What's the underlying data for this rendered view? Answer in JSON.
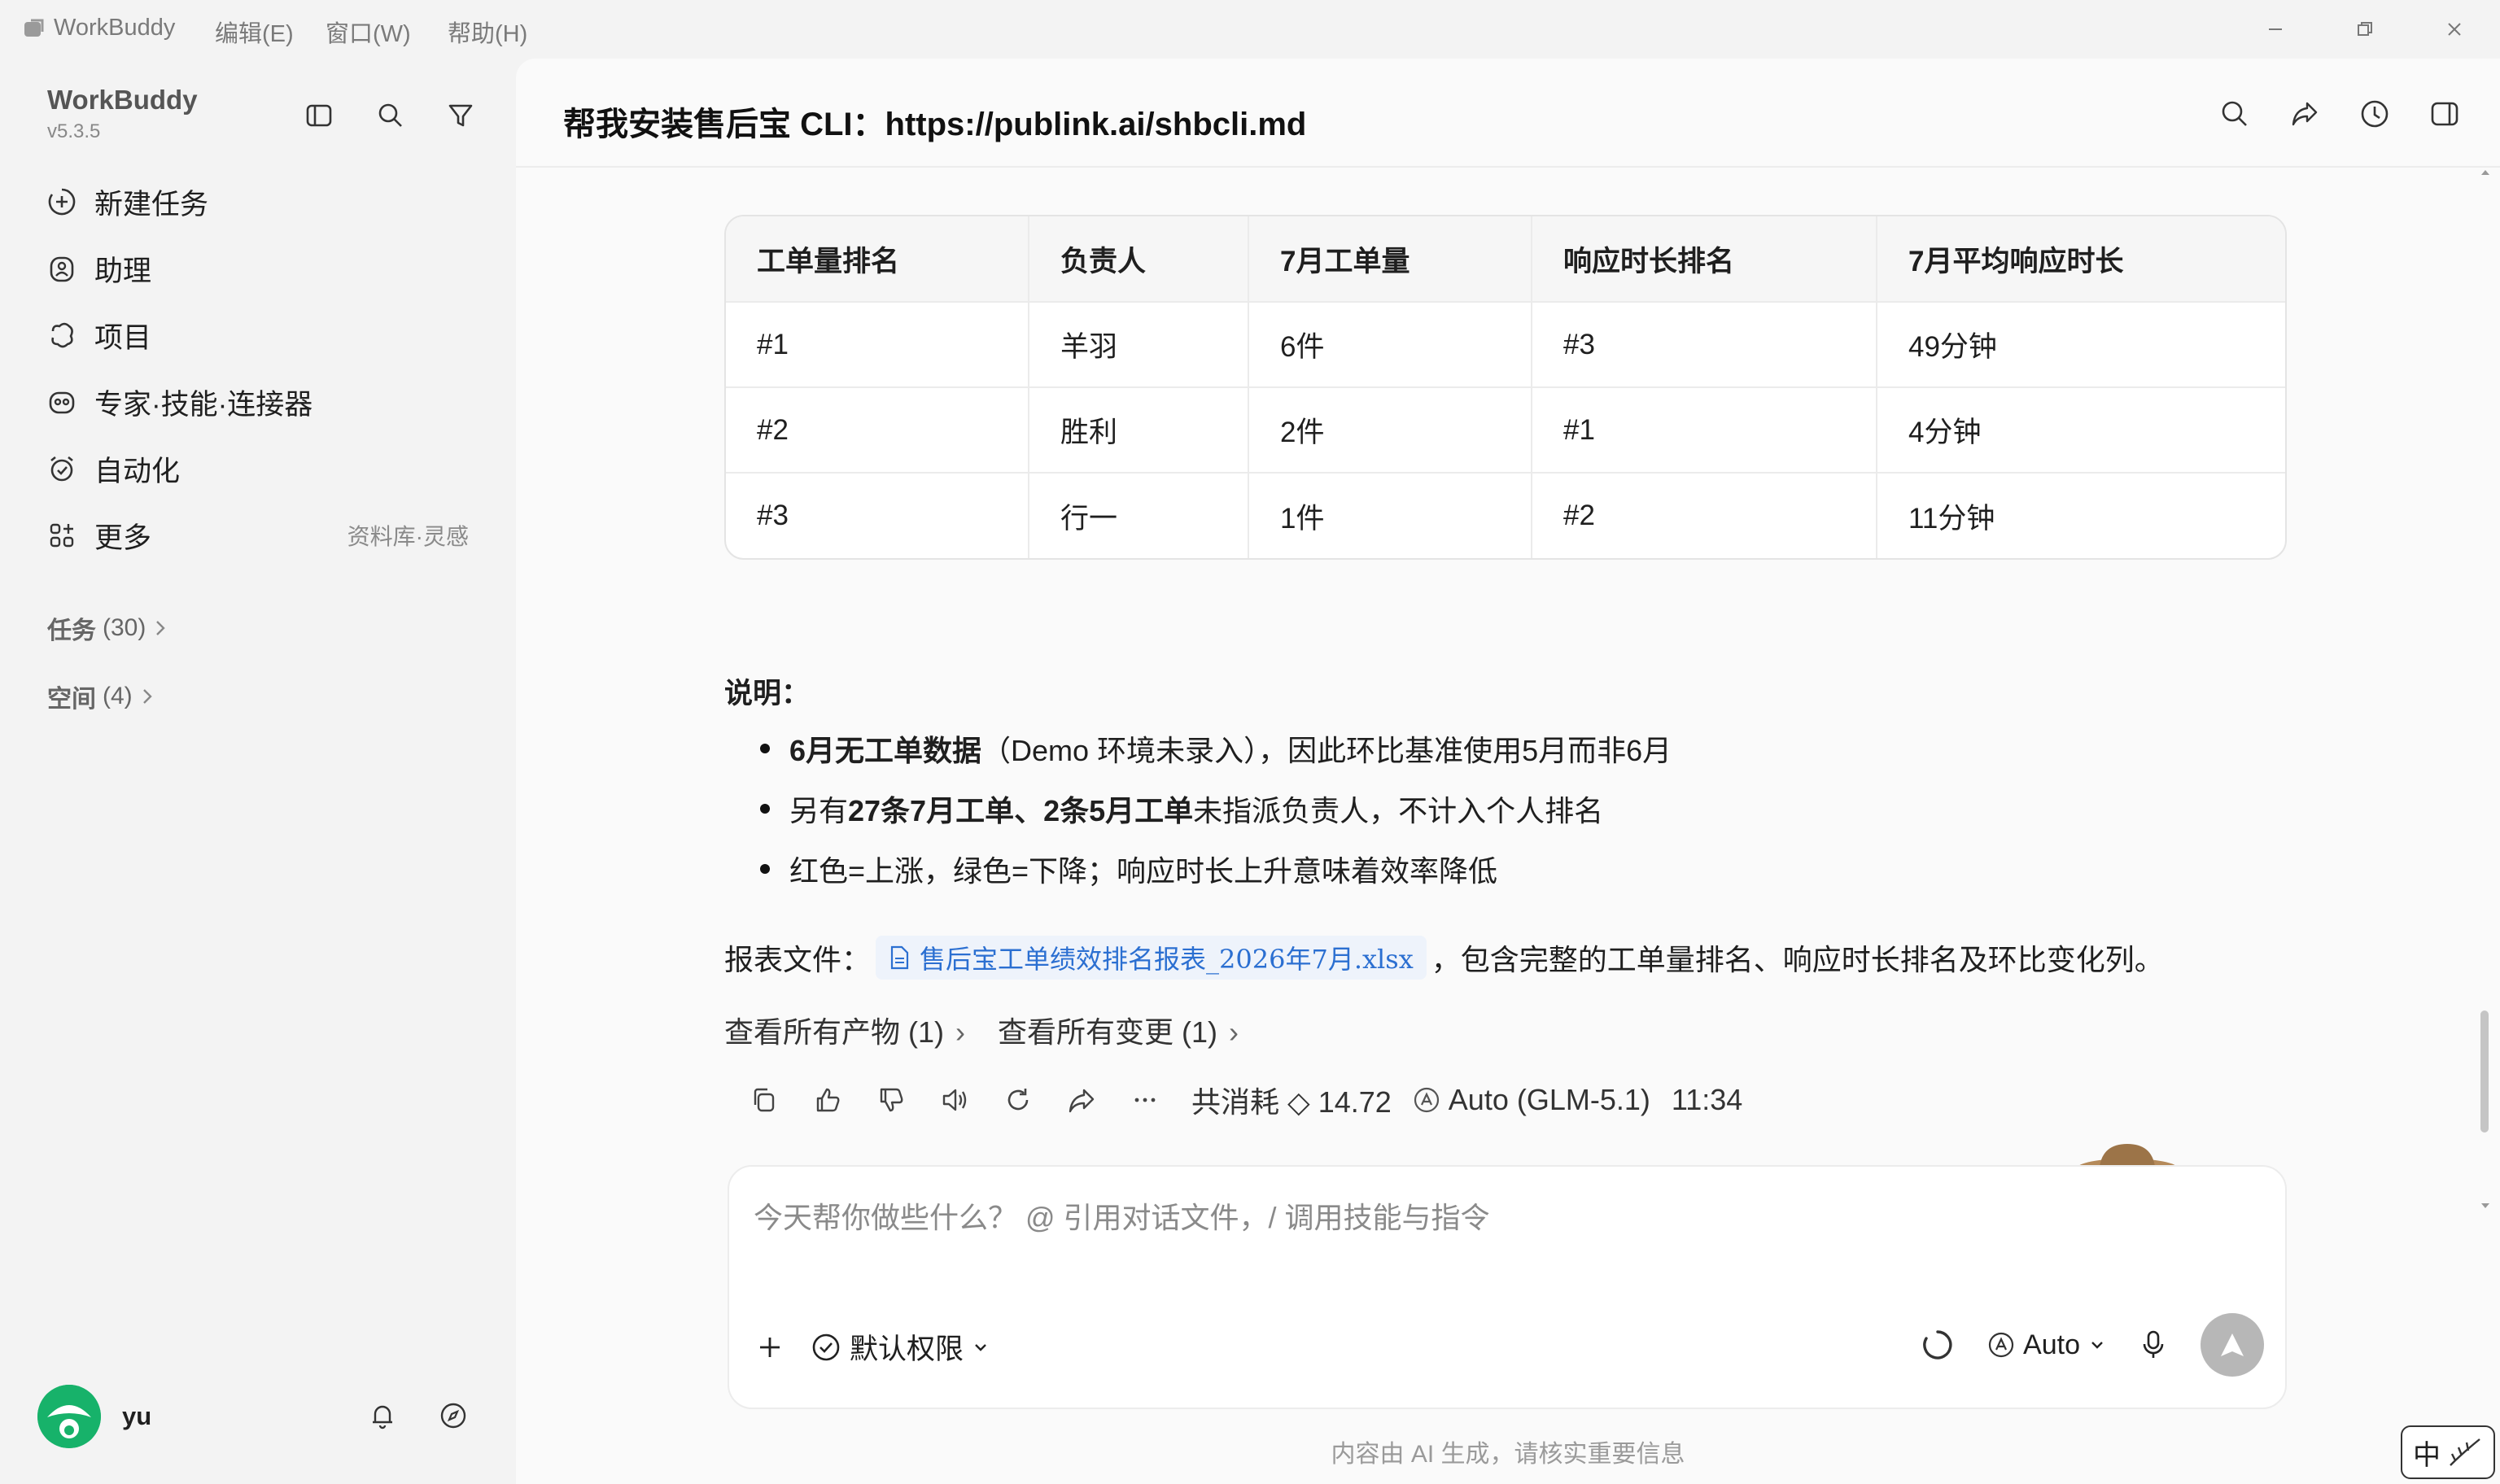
{
  "titlebar": {
    "app_name": "WorkBuddy",
    "menus": [
      "编辑(E)",
      "窗口(W)",
      "帮助(H)"
    ]
  },
  "sidebar": {
    "brand": "WorkBuddy",
    "version": "v5.3.5",
    "nav": [
      {
        "label": "新建任务",
        "icon": "plus-circle-icon"
      },
      {
        "label": "助理",
        "icon": "assistant-icon"
      },
      {
        "label": "项目",
        "icon": "project-icon"
      },
      {
        "label": "专家·技能·连接器",
        "icon": "expert-icon"
      },
      {
        "label": "自动化",
        "icon": "alarm-icon"
      },
      {
        "label": "更多",
        "icon": "apps-icon",
        "hint": "资料库·灵感"
      }
    ],
    "sections": [
      {
        "label": "任务",
        "count": "(30)"
      },
      {
        "label": "空间",
        "count": "(4)"
      }
    ],
    "user": {
      "name": "yu"
    }
  },
  "main": {
    "title": "帮我安装售后宝 CLI：https://publink.ai/shbcli.md",
    "table": {
      "headers": [
        "工单量排名",
        "负责人",
        "7月工单量",
        "响应时长排名",
        "7月平均响应时长"
      ],
      "rows": [
        [
          "#1",
          "羊羽",
          "6件",
          "#3",
          "49分钟"
        ],
        [
          "#2",
          "胜利",
          "2件",
          "#1",
          "4分钟"
        ],
        [
          "#3",
          "行一",
          "1件",
          "#2",
          "11分钟"
        ]
      ]
    },
    "note": {
      "title": "说明：",
      "b1_bold": "6月无工单数据",
      "b1_rest": "（Demo 环境未录入），因此环比基准使用5月而非6月",
      "b2_pre": "另有 ",
      "b2_bold": "27条7月工单、2条5月工单",
      "b2_rest": "未指派负责人，不计入个人排名",
      "b3": "红色=上涨，绿色=下降；响应时长上升意味着效率降低"
    },
    "report": {
      "label": "报表文件：",
      "file": "售后宝工单绩效排名报表_2026年7月.xlsx",
      "suffix": "，包含完整的工单量排名、响应时长排名及环比变化列。"
    },
    "links": {
      "artifacts": "查看所有产物 (1)",
      "changes": "查看所有变更 (1)"
    },
    "meta": {
      "consumption": "共消耗 ◇ 14.72",
      "model": "Auto (GLM-5.1)",
      "time": "11:34"
    },
    "composer": {
      "placeholder": "今天帮你做些什么？ @ 引用对话文件，/ 调用技能与指令",
      "permission": "默认权限",
      "model": "Auto"
    },
    "disclaimer": "内容由 AI 生成，请核实重要信息"
  },
  "ime": {
    "label": "中"
  },
  "colors": {
    "accent": "#17b26a",
    "link": "#2b6fd1",
    "send": "#b7b7b7"
  }
}
